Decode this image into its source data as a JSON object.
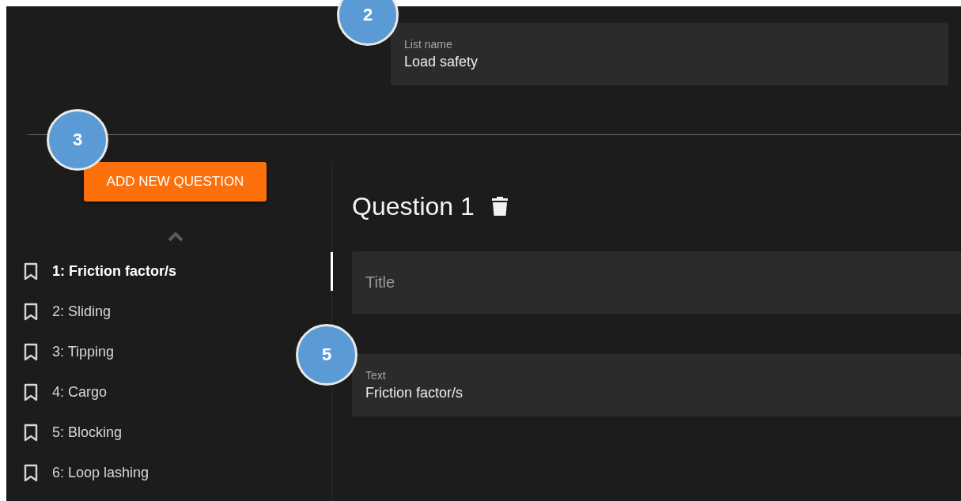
{
  "list_name": {
    "label": "List name",
    "value": "Load safety",
    "callout": "2"
  },
  "add_button": {
    "label": "ADD NEW QUESTION",
    "callout": "3"
  },
  "questions": [
    {
      "label": "1: Friction factor/s",
      "selected": true
    },
    {
      "label": "2: Sliding",
      "selected": false
    },
    {
      "label": "3: Tipping",
      "selected": false
    },
    {
      "label": "4: Cargo",
      "selected": false
    },
    {
      "label": "5: Blocking",
      "selected": false
    },
    {
      "label": "6: Loop lashing",
      "selected": false
    }
  ],
  "editor": {
    "heading": "Question 1",
    "title_field": {
      "placeholder": "Title"
    },
    "text_field": {
      "label": "Text",
      "value": "Friction factor/s",
      "callout": "5"
    }
  }
}
